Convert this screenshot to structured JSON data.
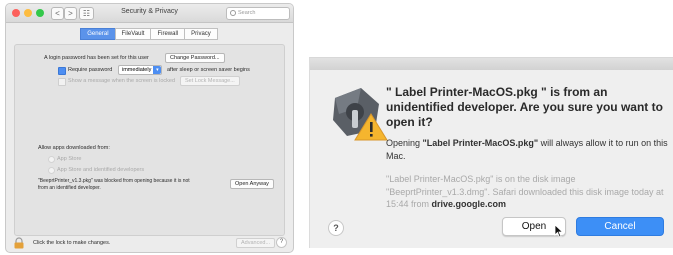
{
  "prefs": {
    "window_title": "Security & Privacy",
    "search_placeholder": "Search",
    "nav": {
      "back": "<",
      "forward": ">",
      "grid": "☷"
    },
    "tabs": [
      {
        "label": "General",
        "active": true
      },
      {
        "label": "FileVault",
        "active": false
      },
      {
        "label": "Firewall",
        "active": false
      },
      {
        "label": "Privacy",
        "active": false
      }
    ],
    "login_password_text": "A login password has been set for this user",
    "change_password_button": "Change Password...",
    "require_password_label": "Require password",
    "require_password_value": "immediately",
    "require_password_suffix": "after sleep or screen saver begins",
    "show_message_label": "Show a message when the screen is locked",
    "set_lock_message_button": "Set Lock Message...",
    "allow_apps_heading": "Allow apps downloaded from:",
    "radio_app_store": "App Store",
    "radio_app_store_identified": "App Store and identified developers",
    "blocked_message_line1": "\"BeeprtPrinter_v1.3.pkg\" was blocked from opening because it is not",
    "blocked_message_line2": "from an identified developer.",
    "open_anyway_button": "Open Anyway",
    "lock_text": "Click the lock to make changes.",
    "advanced_button": "Advanced...",
    "help_button": "?"
  },
  "dialog": {
    "title": "\" Label Printer-MacOS.pkg \" is from an unidentified developer. Are you sure you want to open it?",
    "body_prefix": "Opening ",
    "body_app": "\"Label Printer-MacOS.pkg\"",
    "body_suffix": " will always allow it to run on this Mac.",
    "faint_text": "\"Label Printer-MacOS.pkg\" is on the disk image \"BeeprtPrinter_v1.3.dmg\". Safari downloaded this disk image today at 15:44 from ",
    "faint_domain": "drive.google.com",
    "help_button": "?",
    "open_button": "Open",
    "cancel_button": "Cancel"
  },
  "colors": {
    "accent_blue": "#3d8ff6",
    "tab_active": "#5b93ea",
    "close_red": "#fc605c",
    "minimize_yellow": "#fdbc40",
    "zoom_green": "#34c84a",
    "lock_orange": "#e4a13a"
  }
}
